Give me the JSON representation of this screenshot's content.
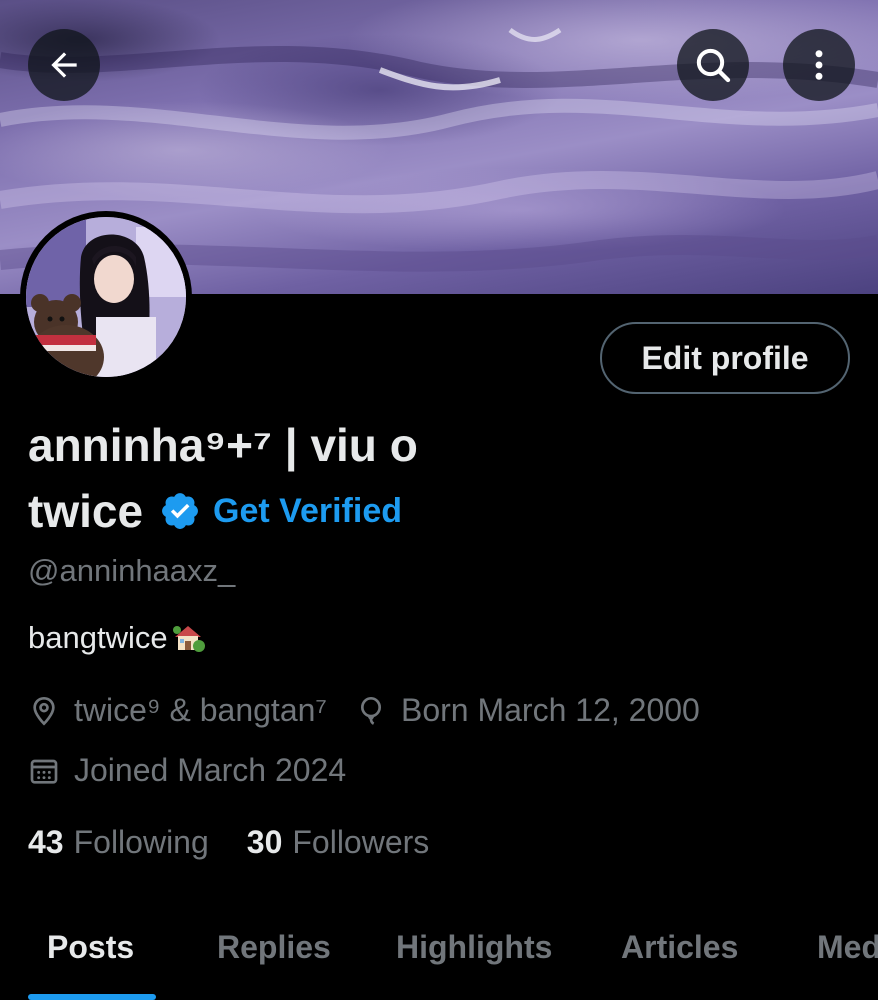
{
  "header": {
    "back_icon": "arrow-left-icon",
    "search_icon": "search-icon",
    "more_icon": "more-vertical-icon"
  },
  "profile": {
    "name_line1": "anninha⁹+⁷ | viu o",
    "name_line2": "twice",
    "verified_icon": "verified-badge-icon",
    "get_verified_label": "Get Verified",
    "handle": "@anninhaaxz_",
    "bio": "bangtwice",
    "bio_emoji": "house-with-garden-icon",
    "edit_profile_label": "Edit profile",
    "location": "twice⁹ & bangtan⁷",
    "birthday": "Born March 12, 2000",
    "joined": "Joined March 2024",
    "following_count": "43",
    "following_label": "Following",
    "followers_count": "30",
    "followers_label": "Followers"
  },
  "tabs": [
    {
      "label": "Posts",
      "active": true
    },
    {
      "label": "Replies",
      "active": false
    },
    {
      "label": "Highlights",
      "active": false
    },
    {
      "label": "Articles",
      "active": false
    },
    {
      "label": "Media",
      "active": false
    }
  ],
  "colors": {
    "accent": "#1d9bf0",
    "secondary_text": "#71767b",
    "primary_text": "#e7e9ea",
    "background": "#000000"
  }
}
